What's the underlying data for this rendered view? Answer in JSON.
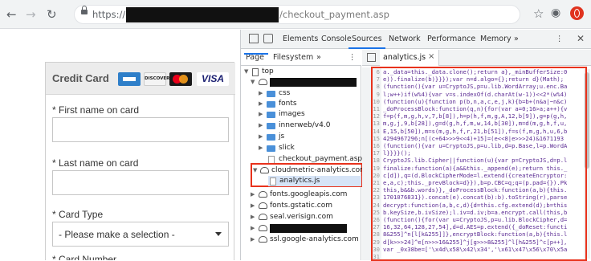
{
  "browser": {
    "back_icon": "arrow-left",
    "forward_icon": "arrow-right",
    "reload_icon": "reload",
    "url_protocol": "https://",
    "url_path": "/checkout_payment.asp",
    "star_icon": "star",
    "account_icon": "account-circle"
  },
  "checkout": {
    "title": "Credit Card",
    "cards": [
      "AMEX",
      "DISCOVER",
      "MasterCard",
      "VISA"
    ],
    "first_name_label": "* First name on card",
    "last_name_label": "* Last name on card",
    "card_type_label": "* Card Type",
    "card_type_value": "- Please make a selection -",
    "card_number_label": "* Card Number"
  },
  "devtools": {
    "tabs": [
      "Elements",
      "Console",
      "Sources",
      "Network",
      "Performance",
      "Memory",
      "»"
    ],
    "subtabs": [
      "Page",
      "Filesystem",
      "»"
    ],
    "tree": {
      "top": "top",
      "items": [
        "css",
        "fonts",
        "images",
        "innerweb/v4.0",
        "js",
        "slick",
        "checkout_payment.asp"
      ],
      "cloudmetric": "cloudmetric-analytics.com",
      "analytics_file": "analytics.js",
      "domains": [
        "fonts.googleapis.com",
        "fonts.gstatic.com",
        "seal.verisign.com",
        "ssl.google-analytics.com"
      ]
    },
    "editor_tab": "analytics.js",
    "editor_tab_close": "×",
    "close": "✕",
    "code": [
      {
        "n": "6",
        "t": "a._data=this._data.clone();return a},_minBufferSize:0"
      },
      {
        "n": "7",
        "t": "e)).finalize(b)}}});var n=d.algo={};return d}(Math);"
      },
      {
        "n": "8",
        "t": "(function(){var u=CryptoJS,p=u.lib.WordArray;u.enc.Ba"
      },
      {
        "n": "9",
        "t": "l;w++)if(w%4){var v=s.indexOf(d.charAt(w-1))<<2*(w%4)"
      },
      {
        "n": "10",
        "t": "(function(u){function p(b,n,a,c,e,j,k){b=b+(n&a|~n&c)"
      },
      {
        "n": "11",
        "t": "_doProcessBlock:function(q,n){for(var a=0;16>a;a++){v"
      },
      {
        "n": "12",
        "t": "f=p(f,m,g,h,v,7,b[8]),h=p(h,f,m,g,A,12,b[9]),g=p(g,h,"
      },
      {
        "n": "13",
        "t": "m,g,j,9,b[28]),g=d(g,h,f,m,w,14,b[30]),m=d(m,g,h,f,u,"
      },
      {
        "n": "14",
        "t": "E,15,b[50]),m=s(m,g,h,f,r,21,b[51]),f=s(f,m,g,h,u,6,b"
      },
      {
        "n": "15",
        "t": "4294967296;n[(c+64>>>9<<4)+15]=(e<<8|e>>>24)&1671193"
      },
      {
        "n": "16",
        "t": "(function(){var u=CryptoJS,p=u.lib,d=p.Base,l=p.WordA"
      },
      {
        "n": "17",
        "t": "l}}}}();"
      },
      {
        "n": "18",
        "t": "CryptoJS.lib.Cipher||function(u){var p=CryptoJS,d=p.l"
      },
      {
        "n": "19",
        "t": "finalize:function(a){a&&this._append(e);return this._"
      },
      {
        "n": "20",
        "t": "c[d]),q=(d.BlockCipherMode=l.extend({createEncryptor:"
      },
      {
        "n": "21",
        "t": "e,a,c);this._prevBlock=d}}),b=p.CBC=q;q=(p.pad={}).Pk"
      },
      {
        "n": "22",
        "t": "this,b&&b.words)},_doProcessBlock:function(a,b){this."
      },
      {
        "n": "23",
        "t": "1701076831}).concat(e).concat(b):b).toString(r),parse"
      },
      {
        "n": "24",
        "t": "decrypt:function(a,b,c,d){d=this.cfg.extend(d);b=this"
      },
      {
        "n": "25",
        "t": "b.keySize,b.ivSize);l.iv=d.iv;b=a.encrypt.call(this,b"
      },
      {
        "n": "26",
        "t": "(function(){for(var u=CryptoJS,p=u.lib.BlockCipher,d="
      },
      {
        "n": "27",
        "t": "16,32,64,128,27,54],d=d.AES=p.extend({_doReset:functi"
      },
      {
        "n": "28",
        "t": "8&255]^n[l[k&255]]},encryptBlock:function(a,b){this.l"
      },
      {
        "n": "29",
        "t": "d[k>>>24]^e[n>>>16&255]^j[g>>>8&255]^l[h&255]^c[p++],"
      },
      {
        "n": "30",
        "t": "var _0x38be=['\\x4d\\x58\\x42\\x34','\\x61\\x47\\x56\\x70\\x5a"
      },
      {
        "n": "31",
        "t": ""
      }
    ]
  }
}
